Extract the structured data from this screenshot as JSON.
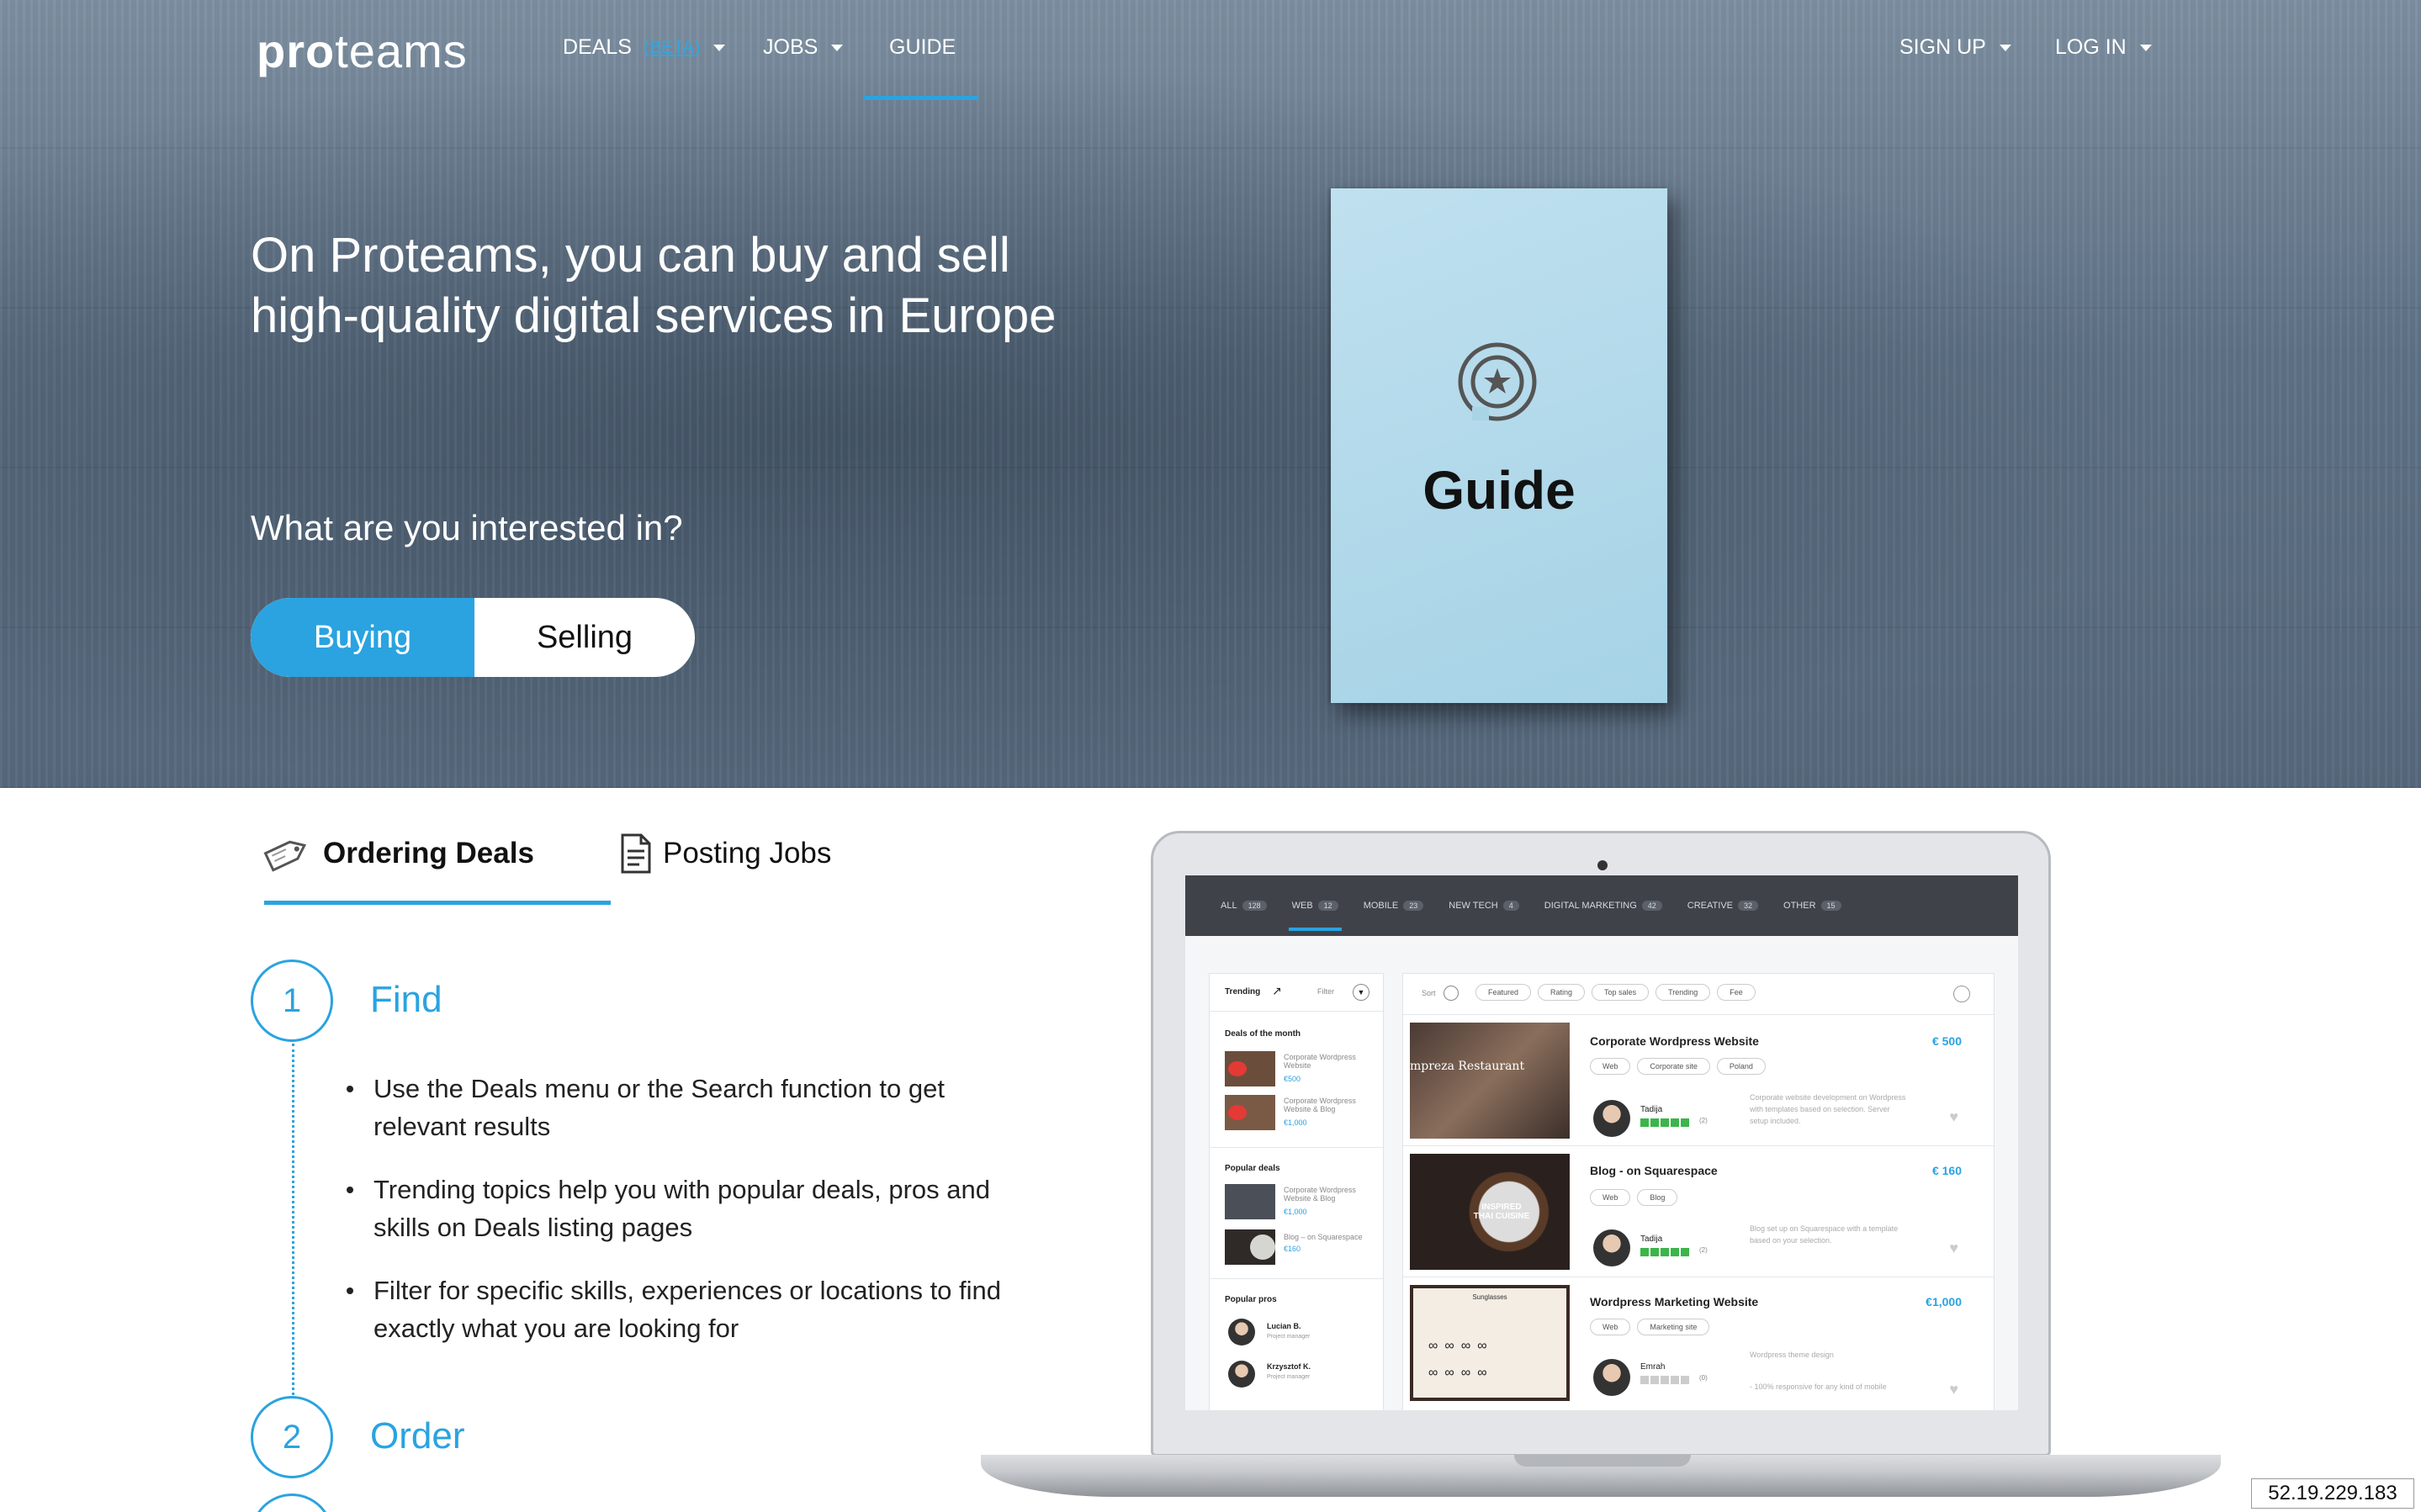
{
  "nav": {
    "logo_bold": "pro",
    "logo_light": "teams",
    "deals": "DEALS",
    "beta": "(BETA)",
    "jobs": "JOBS",
    "guide": "GUIDE",
    "signup": "SIGN UP",
    "login": "LOG IN"
  },
  "hero": {
    "title_line1": "On Proteams, you can buy and sell",
    "title_line2": "high-quality digital services in Europe",
    "question": "What are you interested in?",
    "buying": "Buying",
    "selling": "Selling",
    "book_title": "Guide"
  },
  "tabs": {
    "ordering": "Ordering Deals",
    "posting": "Posting Jobs"
  },
  "steps": [
    {
      "num": "1",
      "title": "Find",
      "bullets": [
        "Use the Deals menu or the Search function to get relevant results",
        "Trending topics help you with popular deals, pros and skills on Deals listing pages",
        "Filter for specific skills, experiences or locations to find exactly what you are looking for"
      ]
    },
    {
      "num": "2",
      "title": "Order"
    }
  ],
  "screen": {
    "categories": [
      {
        "label": "ALL",
        "count": "128"
      },
      {
        "label": "WEB",
        "count": "12"
      },
      {
        "label": "MOBILE",
        "count": "23"
      },
      {
        "label": "NEW TECH",
        "count": "4"
      },
      {
        "label": "DIGITAL MARKETING",
        "count": "42"
      },
      {
        "label": "CREATIVE",
        "count": "32"
      },
      {
        "label": "OTHER",
        "count": "15"
      }
    ],
    "trending": "Trending",
    "filter": "Filter",
    "sort": "Sort",
    "sort_pills": [
      "Featured",
      "Rating",
      "Top sales",
      "Trending",
      "Fee"
    ],
    "deals_of_month": "Deals of the month",
    "side_deals": [
      {
        "title": "Corporate Wordpress Website",
        "price": "€500"
      },
      {
        "title": "Corporate Wordpress Website & Blog",
        "price": "€1,000"
      }
    ],
    "popular_deals": "Popular deals",
    "popular_items": [
      {
        "title": "Corporate Wordpress Website & Blog",
        "price": "€1,000"
      },
      {
        "title": "Blog – on Squarespace",
        "price": "€160"
      }
    ],
    "popular_pros": "Popular pros",
    "pros": [
      {
        "name": "Lucian B.",
        "role": "Project manager"
      },
      {
        "name": "Krzysztof K.",
        "role": "Project manager"
      }
    ],
    "deals": [
      {
        "title": "Corporate Wordpress Website",
        "price": "€ 500",
        "tags": [
          "Web",
          "Corporate site",
          "Poland"
        ],
        "seller": "Tadija",
        "reviews": "(2)",
        "desc": "Corporate website development on Wordpress with templates based on selection. Server setup included.",
        "thumb_text": "mpreza Restaurant"
      },
      {
        "title": "Blog - on Squarespace",
        "price": "€ 160",
        "tags": [
          "Web",
          "Blog"
        ],
        "seller": "Tadija",
        "reviews": "(2)",
        "desc": "Blog set up on Squarespace with a template based on your selection.",
        "thumb_text": "INSPIRED THAI CUISINE"
      },
      {
        "title": "Wordpress Marketing Website",
        "price": "€1,000",
        "tags": [
          "Web",
          "Marketing site"
        ],
        "seller": "Emrah",
        "reviews": "(0)",
        "desc": "Wordpress theme design",
        "desc2": "- 100% responsive for any kind of mobile",
        "thumb_text": "Sunglasses"
      }
    ]
  },
  "ip": "52.19.229.183",
  "colors": {
    "accent": "#2aa3e0",
    "dark": "#3f4349"
  }
}
